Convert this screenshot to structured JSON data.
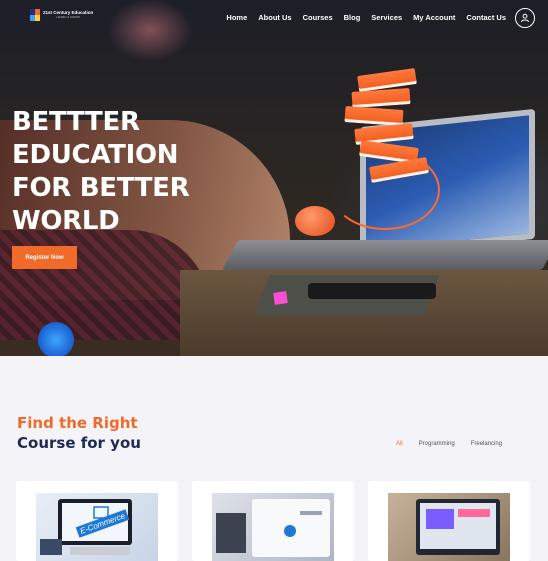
{
  "brand": {
    "name": "21st Century Education",
    "tagline": "LEARN & GROW"
  },
  "nav": {
    "items": [
      "Home",
      "About Us",
      "Courses",
      "Blog",
      "Services",
      "My Account",
      "Contact Us"
    ]
  },
  "hero": {
    "headline": [
      "BETTTER",
      "EDUCATION",
      "FOR BETTER",
      "WORLD"
    ],
    "cta_label": "Register Now"
  },
  "courses": {
    "title_line1": "Find the Right",
    "title_line2": "Course for you",
    "filters": [
      "All",
      "Programming",
      "Freelancing"
    ],
    "active_filter": "All",
    "card_image_label": "E-Commerce"
  },
  "colors": {
    "accent": "#f06a2a",
    "heading": "#1f2a52"
  }
}
